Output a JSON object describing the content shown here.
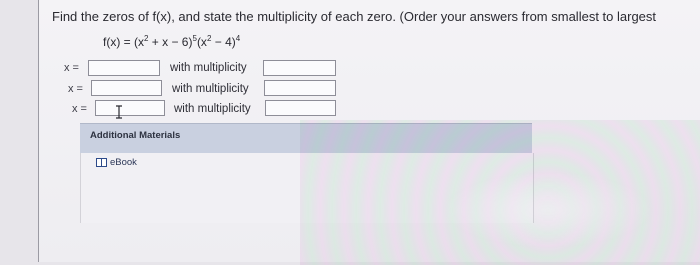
{
  "question": {
    "prompt": "Find the zeros of f(x), and state the multiplicity of each zero. (Order your answers from smallest to largest",
    "function_lhs": "f(x) = (x",
    "exp1": "2",
    "mid1": " + x − 6)",
    "exp2": "5",
    "mid2": "(x",
    "exp3": "2",
    "mid3": " − 4)",
    "exp4": "4"
  },
  "rows": [
    {
      "x_label": "x =",
      "x_value": "",
      "mult_label": "with multiplicity",
      "mult_value": ""
    },
    {
      "x_label": "x =",
      "x_value": "",
      "mult_label": "with multiplicity",
      "mult_value": ""
    },
    {
      "x_label": "x =",
      "x_value": "",
      "mult_label": "with multiplicity",
      "mult_value": ""
    }
  ],
  "additional": {
    "title": "Additional Materials",
    "ebook_label": "eBook"
  },
  "icons": {
    "text_cursor": "text-cursor-icon",
    "book": "book-icon"
  }
}
